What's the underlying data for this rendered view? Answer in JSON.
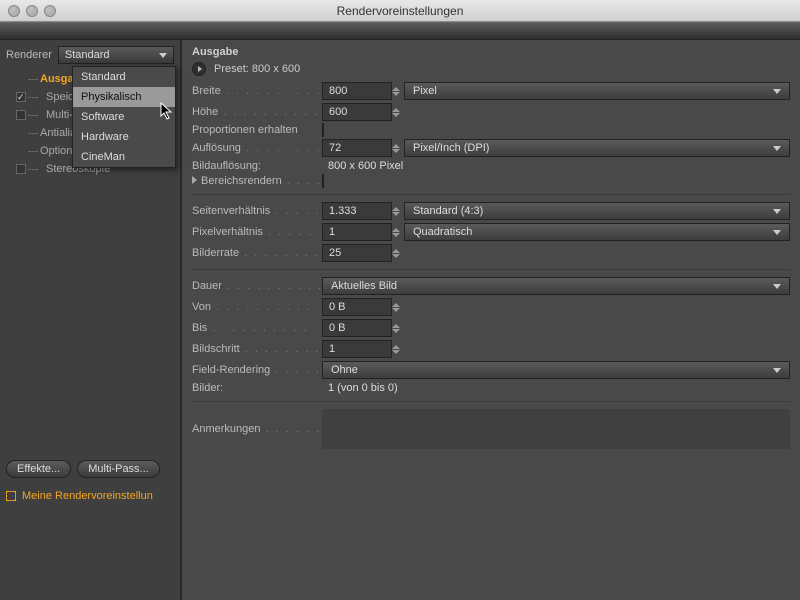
{
  "window": {
    "title": "Rendervoreinstellungen"
  },
  "sidebar": {
    "renderer_label": "Renderer",
    "renderer_value": "Standard",
    "menu": [
      "Standard",
      "Physikalisch",
      "Software",
      "Hardware",
      "CineMan"
    ],
    "menu_hover_index": 1,
    "tree": [
      {
        "label": "Ausgabe",
        "selected": true,
        "checkbox": null
      },
      {
        "label": "Speichern",
        "selected": false,
        "checkbox": true
      },
      {
        "label": "Multi-Pass",
        "selected": false,
        "checkbox": false
      },
      {
        "label": "Antialiasing",
        "selected": false,
        "checkbox": null
      },
      {
        "label": "Optionen",
        "selected": false,
        "checkbox": null
      },
      {
        "label": "Stereoskopie",
        "selected": false,
        "checkbox": false
      }
    ],
    "effects_btn": "Effekte...",
    "multipass_btn": "Multi-Pass...",
    "preset_label": "Meine Rendervoreinstellun"
  },
  "output": {
    "section": "Ausgabe",
    "preset_label": "Preset: 800 x 600",
    "width_label": "Breite",
    "width_value": "800",
    "width_unit": "Pixel",
    "height_label": "Höhe",
    "height_value": "600",
    "lock_label": "Proportionen erhalten",
    "res_label": "Auflösung",
    "res_value": "72",
    "res_unit": "Pixel/Inch (DPI)",
    "imgres_label": "Bildauflösung:",
    "imgres_value": "800 x 600 Pixel",
    "region_label": "Bereichsrendern",
    "aspect_label": "Seitenverhältnis",
    "aspect_value": "1.333",
    "aspect_select": "Standard (4:3)",
    "pixasp_label": "Pixelverhältnis",
    "pixasp_value": "1",
    "pixasp_select": "Quadratisch",
    "fps_label": "Bilderrate",
    "fps_value": "25",
    "dur_label": "Dauer",
    "dur_select": "Aktuelles Bild",
    "from_label": "Von",
    "from_value": "0 B",
    "to_label": "Bis",
    "to_value": "0 B",
    "step_label": "Bildschritt",
    "step_value": "1",
    "field_label": "Field-Rendering",
    "field_select": "Ohne",
    "frames_label": "Bilder:",
    "frames_value": "1 (von 0 bis 0)",
    "notes_label": "Anmerkungen"
  }
}
